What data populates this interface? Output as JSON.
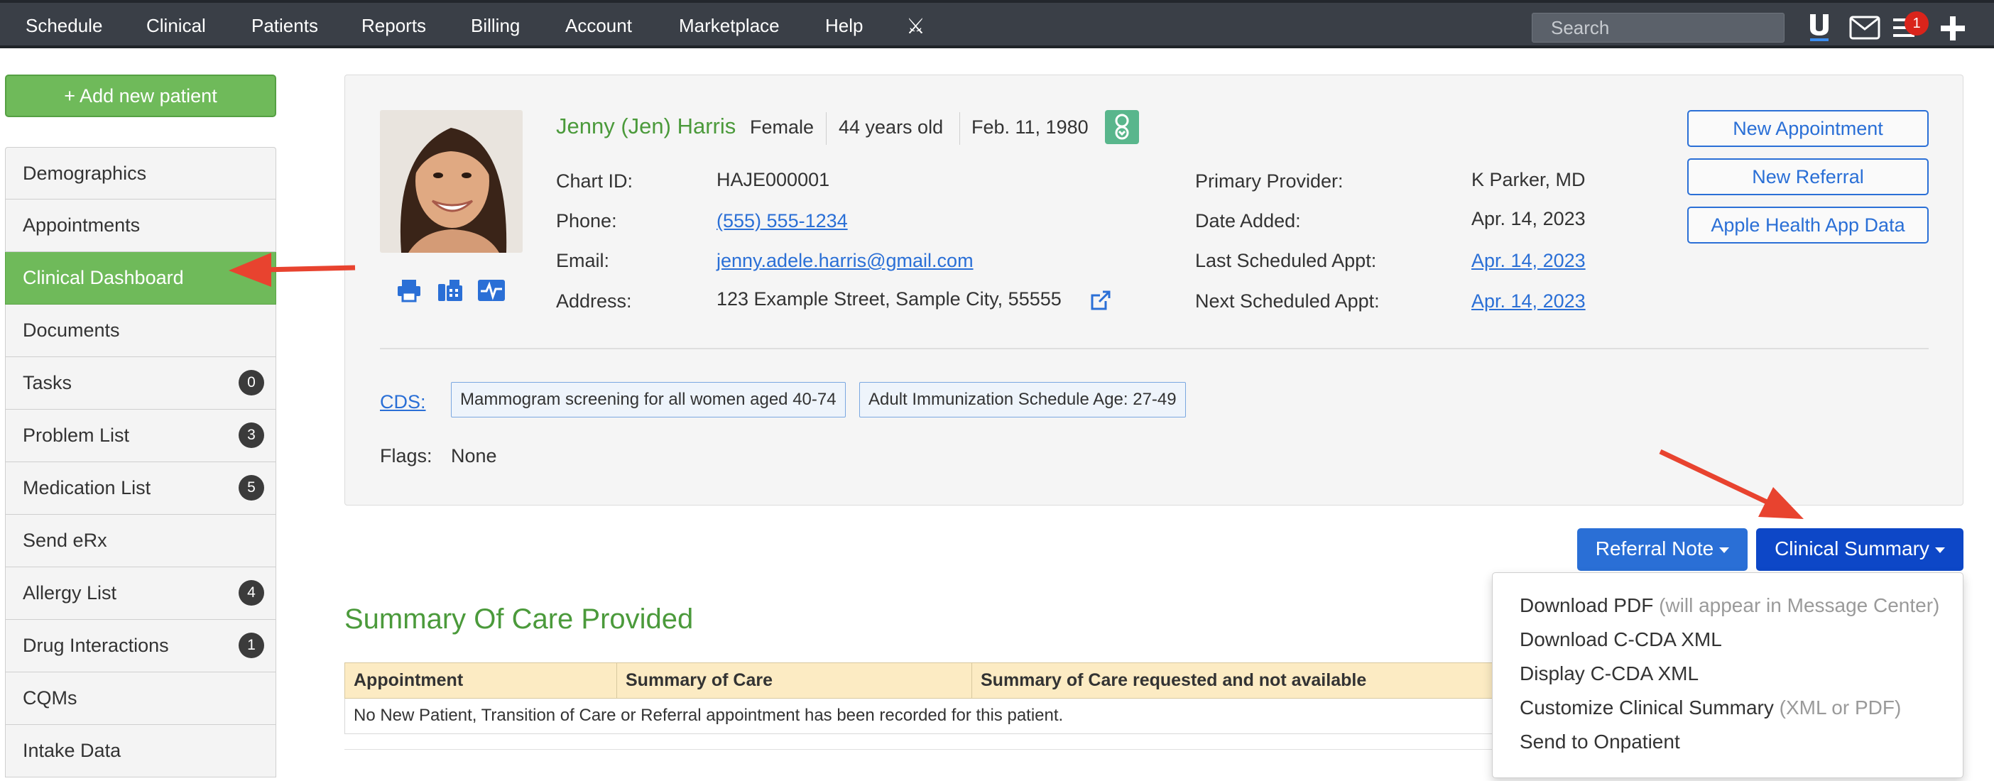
{
  "nav": {
    "items": [
      "Schedule",
      "Clinical",
      "Patients",
      "Reports",
      "Billing",
      "Account",
      "Marketplace",
      "Help"
    ],
    "search_placeholder": "Search",
    "notification_count": "1"
  },
  "sidebar": {
    "add_button": "+ Add new patient",
    "items": [
      {
        "label": "Demographics",
        "count": null
      },
      {
        "label": "Appointments",
        "count": null
      },
      {
        "label": "Clinical Dashboard",
        "count": null
      },
      {
        "label": "Documents",
        "count": null
      },
      {
        "label": "Tasks",
        "count": "0"
      },
      {
        "label": "Problem List",
        "count": "3"
      },
      {
        "label": "Medication List",
        "count": "5"
      },
      {
        "label": "Send eRx",
        "count": null
      },
      {
        "label": "Allergy List",
        "count": "4"
      },
      {
        "label": "Drug Interactions",
        "count": "1"
      },
      {
        "label": "CQMs",
        "count": null
      },
      {
        "label": "Intake Data",
        "count": null
      }
    ]
  },
  "patient": {
    "name": "Jenny (Jen) Harris",
    "gender": "Female",
    "age": "44 years old",
    "dob": "Feb. 11, 1980",
    "labels": {
      "chart_id": "Chart ID:",
      "phone": "Phone:",
      "email": "Email:",
      "address": "Address:",
      "primary_provider": "Primary Provider:",
      "date_added": "Date Added:",
      "last_appt": "Last Scheduled Appt:",
      "next_appt": "Next Scheduled Appt:"
    },
    "chart_id": "HAJE000001",
    "phone": "(555) 555-1234",
    "email": "jenny.adele.harris@gmail.com",
    "address": "123 Example Street, Sample City, 55555",
    "primary_provider": "K Parker, MD",
    "date_added": "Apr. 14, 2023",
    "last_appt": "Apr. 14, 2023",
    "next_appt": "Apr. 14, 2023",
    "cds_label": "CDS:",
    "cds_tags": [
      "Mammogram screening for all women aged 40-74",
      "Adult Immunization Schedule Age: 27-49"
    ],
    "flags_label": "Flags:",
    "flags_value": "None"
  },
  "actions": {
    "new_appointment": "New Appointment",
    "new_referral": "New Referral",
    "apple_health": "Apple Health App Data",
    "referral_note": "Referral Note",
    "clinical_summary": "Clinical Summary"
  },
  "summary": {
    "title": "Summary Of Care Provided",
    "columns": [
      "Appointment",
      "Summary of Care",
      "Summary of Care requested and not available"
    ],
    "empty_message": "No New Patient, Transition of Care or Referral appointment has been recorded for this patient."
  },
  "dropdown": {
    "items": [
      {
        "label": "Download PDF",
        "hint": "(will appear in Message Center)"
      },
      {
        "label": "Download C-CDA XML",
        "hint": ""
      },
      {
        "label": "Display C-CDA XML",
        "hint": ""
      },
      {
        "label": "Customize Clinical Summary",
        "hint": "(XML or PDF)"
      },
      {
        "label": "Send to Onpatient",
        "hint": ""
      }
    ]
  },
  "colors": {
    "accent_green": "#6fba5a",
    "link_blue": "#2a6fd6",
    "button_blue": "#2a6fd6",
    "button_dark_blue": "#0d47c7",
    "annotation_red": "#e8432f"
  }
}
